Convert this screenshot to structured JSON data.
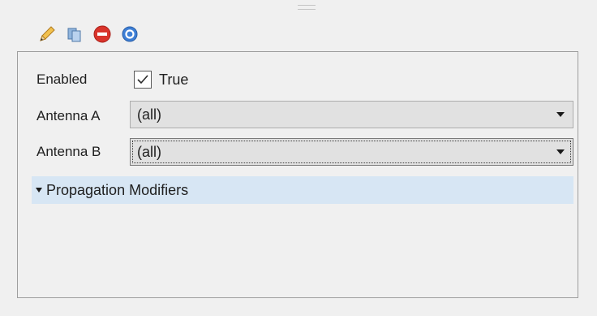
{
  "toolbar": {
    "buttons": [
      {
        "icon": "pencil-icon",
        "label": "Edit"
      },
      {
        "icon": "copy-icon",
        "label": "Copy"
      },
      {
        "icon": "delete-icon",
        "label": "Delete"
      },
      {
        "icon": "help-icon",
        "label": "Help"
      }
    ]
  },
  "properties": {
    "enabled": {
      "label": "Enabled",
      "checked": true,
      "value_text": "True"
    },
    "antenna_a": {
      "label": "Antenna A",
      "value": "(all)"
    },
    "antenna_b": {
      "label": "Antenna B",
      "value": "(all)"
    }
  },
  "section": {
    "label": "Propagation Modifiers",
    "expanded": true
  },
  "colors": {
    "background": "#f0f0f0",
    "section_header": "#d7e6f4",
    "delete_red": "#d9342b",
    "help_blue": "#3d7fd6",
    "pencil_yellow": "#f2c14e"
  }
}
